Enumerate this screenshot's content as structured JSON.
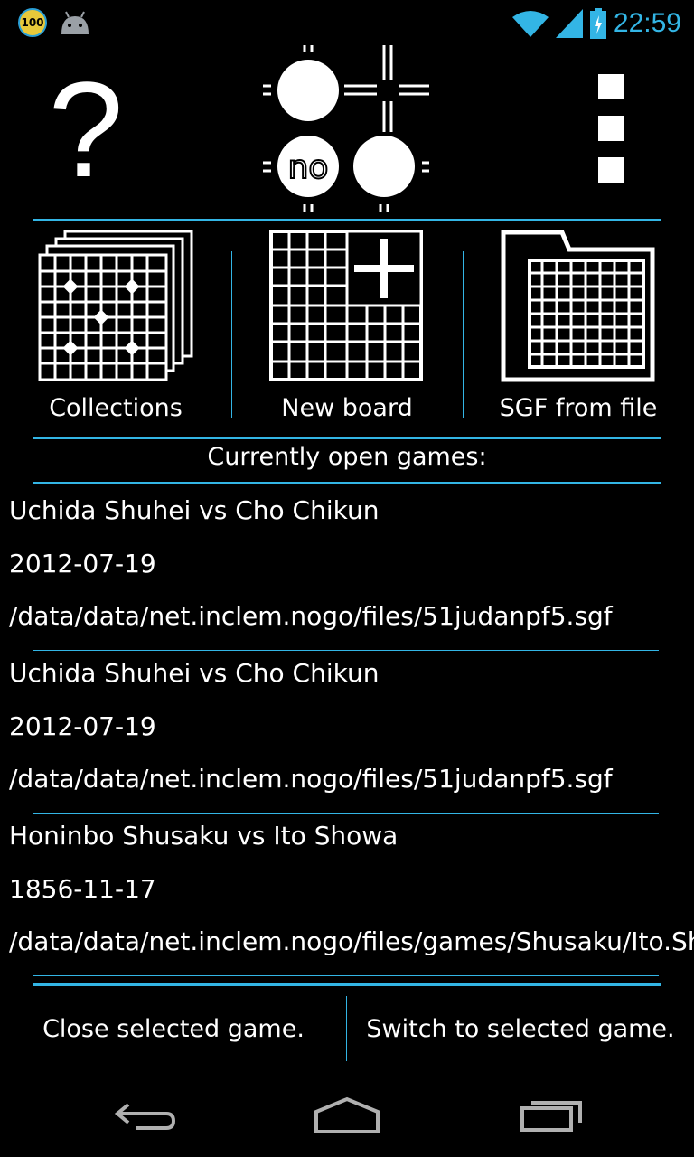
{
  "status_bar": {
    "badge": "100",
    "icons": [
      "badge-icon",
      "android-icon",
      "wifi-icon",
      "signal-icon",
      "battery-icon"
    ],
    "time": "22:59"
  },
  "top_bar": {
    "help_label": "?",
    "logo_text": "no",
    "menu_icon": "overflow-menu-icon"
  },
  "tiles": [
    {
      "label": "Collections",
      "icon": "collections-icon"
    },
    {
      "label": "New board",
      "icon": "new-board-icon"
    },
    {
      "label": "SGF from file",
      "icon": "folder-icon"
    }
  ],
  "open_games_header": "Currently open games:",
  "games": [
    {
      "title": "Uchida Shuhei vs Cho Chikun",
      "date": "2012-07-19",
      "path": "/data/data/net.inclem.nogo/files/51judanpf5.sgf"
    },
    {
      "title": "Uchida Shuhei vs Cho Chikun",
      "date": "2012-07-19",
      "path": "/data/data/net.inclem.nogo/files/51judanpf5.sgf"
    },
    {
      "title": "Honinbo Shusaku vs Ito Showa",
      "date": "1856-11-17",
      "path": "/data/data/net.inclem.nogo/files/games/Shusaku/Ito.Sh"
    }
  ],
  "buttons": {
    "close": "Close selected game.",
    "switch": "Switch to selected game."
  },
  "nav": [
    "back-icon",
    "home-icon",
    "recents-icon"
  ],
  "colors": {
    "accent": "#33b5e5",
    "background": "#000000",
    "text": "#ffffff"
  }
}
